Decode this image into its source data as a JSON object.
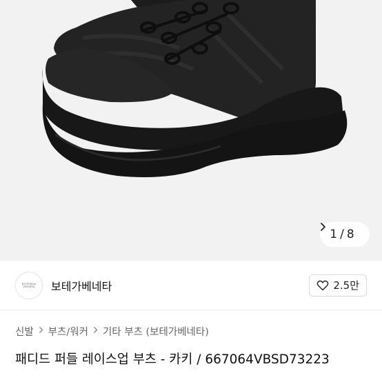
{
  "gallery": {
    "current": "1",
    "separator": "/",
    "total": "8",
    "next_icon": "chevron-right-icon",
    "background": "#f2f2f2"
  },
  "brand": {
    "logo_text": "BOTTEGA VENETA",
    "name": "보테가베네타"
  },
  "like": {
    "icon": "heart-outline-icon",
    "count": "2.5만"
  },
  "breadcrumb": [
    "신발",
    "부츠/워커",
    "기타 부츠 (보테가베네타)"
  ],
  "breadcrumb_separator_icon": "chevron-right-icon",
  "product": {
    "title": "패디드 퍼들 레이스업 부츠 - 카키 / 667064VBSD73223"
  },
  "colors": {
    "boot": "#1a1a1a",
    "text_primary": "#111111",
    "text_secondary": "#666666"
  }
}
